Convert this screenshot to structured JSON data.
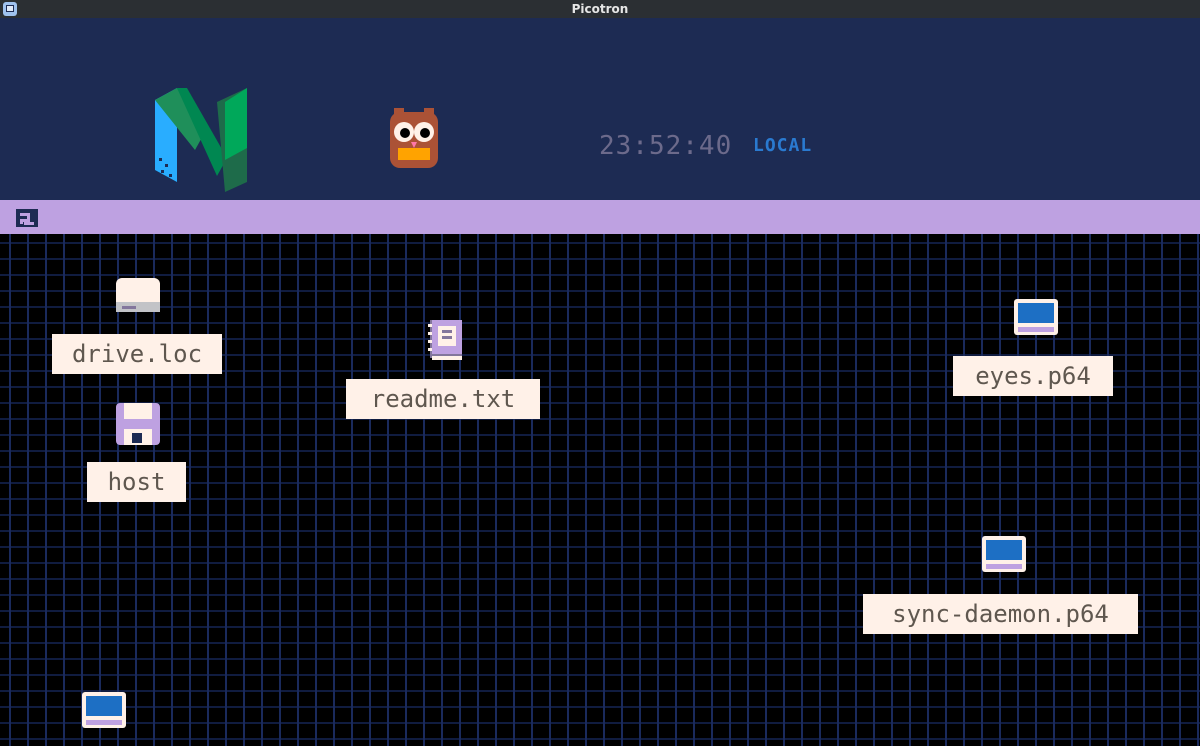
{
  "window": {
    "title": "Picotron"
  },
  "top_panel": {
    "clock": "23:52:40",
    "timezone": "LOCAL"
  },
  "desktop": {
    "items": [
      {
        "label": "drive.loc",
        "icon": "drive-icon"
      },
      {
        "label": "readme.txt",
        "icon": "text-file-icon"
      },
      {
        "label": "eyes.p64",
        "icon": "cartridge-icon"
      },
      {
        "label": "host",
        "icon": "floppy-icon"
      },
      {
        "label": "sync-daemon.p64",
        "icon": "cartridge-icon"
      },
      {
        "label": "",
        "icon": "cartridge-icon"
      }
    ]
  },
  "colors": {
    "panel": "#1d2b53",
    "strip": "#bea1e1",
    "label_bg": "#fff1e8",
    "label_text": "#5f574f",
    "timezone": "#2a7ad0"
  }
}
